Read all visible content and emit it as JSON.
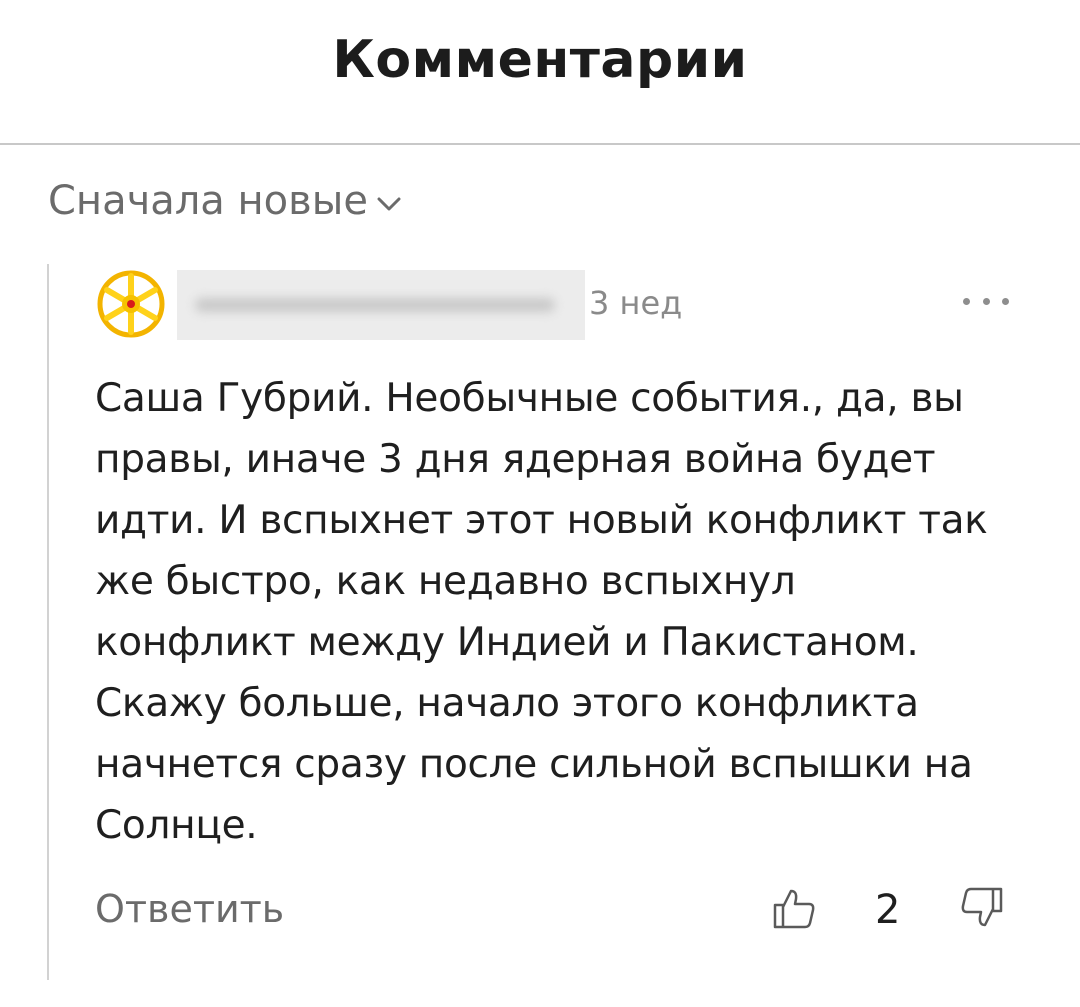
{
  "header": {
    "title": "Комментарии"
  },
  "sort": {
    "label": "Сначала новые",
    "icon": "chevron-down-icon"
  },
  "comment": {
    "author_name": "",
    "timestamp": "3 нед",
    "avatar_icon": "kolovrat-sun-icon",
    "avatar_colors": {
      "ring": "#f3b400",
      "rays": "#ffd21a",
      "center": "#d81b1b"
    },
    "text": "Саша Губрий. Необычные события., да, вы правы, иначе 3 дня ядерная война будет идти. И вспыхнет этот новый конфликт так же быстро, как недавно вспыхнул конфликт между Индией и Пакистаном. Скажу больше, начало этого конфликта начнется сразу после сильной вспышки на Солнце.",
    "reply_label": "Ответить",
    "like_count": "2",
    "like_icon": "thumbs-up-icon",
    "dislike_icon": "thumbs-down-icon",
    "more_icon": "more-dots-icon"
  }
}
